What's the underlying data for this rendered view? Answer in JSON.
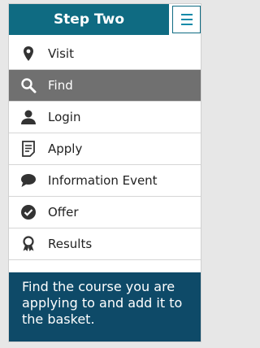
{
  "header": {
    "title": "Step Two",
    "menu_icon": "hamburger-icon"
  },
  "menu": {
    "items": [
      {
        "label": "Visit",
        "icon": "map-pin-icon"
      },
      {
        "label": "Find",
        "icon": "search-icon",
        "active": true
      },
      {
        "label": "Login",
        "icon": "user-icon"
      },
      {
        "label": "Apply",
        "icon": "document-icon"
      },
      {
        "label": "Information Event",
        "icon": "speech-bubble-icon"
      },
      {
        "label": "Offer",
        "icon": "check-circle-icon"
      },
      {
        "label": "Results",
        "icon": "award-ribbon-icon"
      }
    ]
  },
  "footer": {
    "text": "Find the course you are applying to and add it to the basket."
  },
  "colors": {
    "brand": "#0f6b82",
    "active": "#707070",
    "footer": "#0e4a68"
  }
}
